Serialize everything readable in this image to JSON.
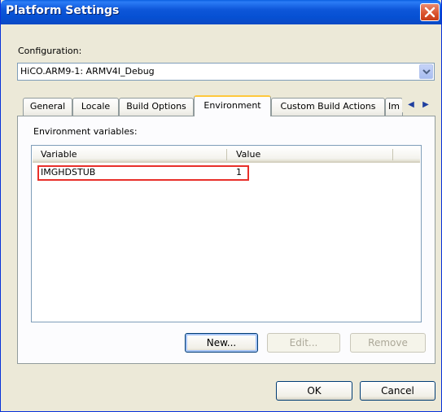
{
  "window": {
    "title": "Platform Settings"
  },
  "configuration": {
    "label": "Configuration:",
    "selected": "HiCO.ARM9-1: ARMV4I_Debug"
  },
  "tabs": [
    {
      "label": "General"
    },
    {
      "label": "Locale"
    },
    {
      "label": "Build Options"
    },
    {
      "label": "Environment"
    },
    {
      "label": "Custom Build Actions"
    },
    {
      "label": "Im"
    }
  ],
  "environment": {
    "label": "Environment variables:",
    "columns": [
      "Variable",
      "Value"
    ],
    "rows": [
      {
        "variable": "IMGHDSTUB",
        "value": "1"
      }
    ],
    "buttons": {
      "new": "New...",
      "edit": "Edit...",
      "remove": "Remove"
    }
  },
  "footer": {
    "ok": "OK",
    "cancel": "Cancel"
  },
  "colors": {
    "titlebar": "#0650d3",
    "highlight": "#e8302a",
    "active_tab_accent": "#ffc83c"
  }
}
